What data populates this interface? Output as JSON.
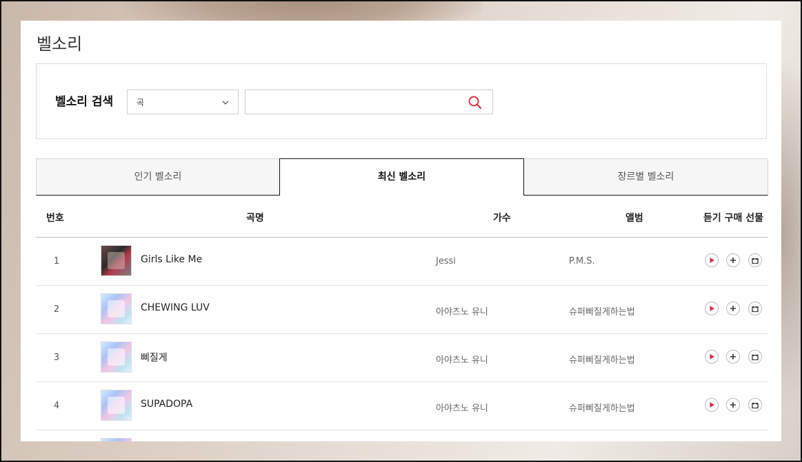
{
  "page": {
    "title": "벨소리"
  },
  "search": {
    "label": "벨소리 검색",
    "select_value": "곡",
    "input_value": "",
    "input_placeholder": ""
  },
  "tabs": [
    {
      "label": "인기 벨소리",
      "active": false
    },
    {
      "label": "최신 벨소리",
      "active": true
    },
    {
      "label": "장르별 벨소리",
      "active": false
    }
  ],
  "table": {
    "headers": {
      "num": "번호",
      "title": "곡명",
      "artist": "가수",
      "album": "앨범",
      "actions": "듣기 구매 선물"
    },
    "rows": [
      {
        "num": "1",
        "title": "Girls Like Me",
        "artist": "Jessi",
        "album": "P.M.S."
      },
      {
        "num": "2",
        "title": "CHEWING LUV",
        "artist": "아야츠노 유니",
        "album": "슈퍼삐질게하는법"
      },
      {
        "num": "3",
        "title": "삐질게",
        "artist": "아야츠노 유니",
        "album": "슈퍼삐질게하는법"
      },
      {
        "num": "4",
        "title": "SUPADOPA",
        "artist": "아야츠노 유니",
        "album": "슈퍼삐질게하는법"
      }
    ]
  },
  "icons": {
    "search": "search-icon",
    "dropdown": "chevron-down-icon",
    "play": "play-icon",
    "add": "plus-icon",
    "gift": "gift-icon"
  },
  "colors": {
    "accent": "#e0303f",
    "text": "#222222",
    "border": "#dcdcdc"
  }
}
